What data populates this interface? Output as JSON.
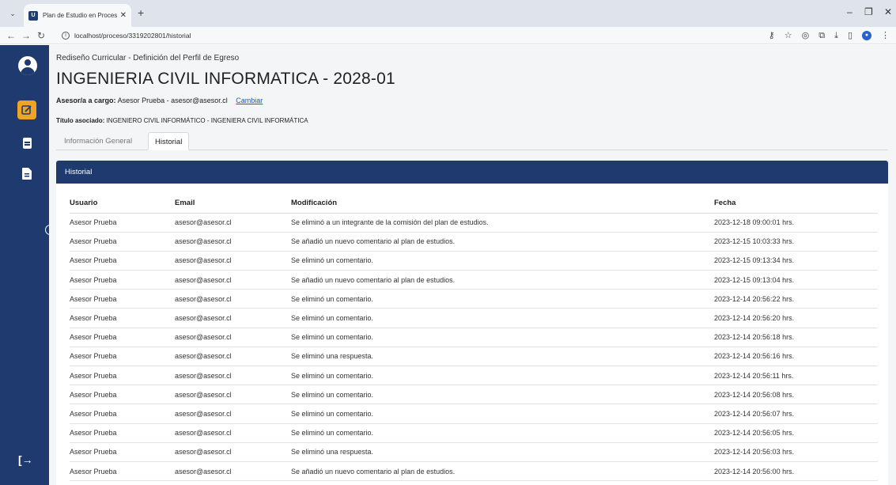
{
  "browser": {
    "tab_title": "Plan de Estudio en Proceso - Si",
    "tab_favicon": "U",
    "url": "localhost/proceso/3319202801/historial"
  },
  "sidebar": {
    "items": [
      {
        "name": "edit",
        "icon": "edit-icon"
      },
      {
        "name": "list",
        "icon": "document-icon"
      },
      {
        "name": "file",
        "icon": "file-icon"
      }
    ],
    "logout_icon": "logout-icon"
  },
  "header": {
    "subtitle": "Rediseño Curricular - Definición del Perfil de Egreso",
    "title": "INGENIERIA CIVIL INFORMATICA - 2028-01",
    "asesor_label": "Asesor/a a cargo:",
    "asesor_value": "Asesor Prueba - asesor@asesor.cl",
    "change_link": "Cambiar",
    "titulo_label": "Título asociado:",
    "titulo_value": "INGENIERO CIVIL INFORMÁTICO - INGENIERA CIVIL INFORMÁTICA"
  },
  "tabs": {
    "general": "Información General",
    "historial": "Historial"
  },
  "historial": {
    "card_title": "Historial",
    "columns": [
      "Usuario",
      "Email",
      "Modificación",
      "Fecha"
    ],
    "rows": [
      [
        "Asesor Prueba",
        "asesor@asesor.cl",
        "Se eliminó a un integrante de la comisión del plan de estudios.",
        "2023-12-18 09:00:01 hrs."
      ],
      [
        "Asesor Prueba",
        "asesor@asesor.cl",
        "Se añadió un nuevo comentario al plan de estudios.",
        "2023-12-15 10:03:33 hrs."
      ],
      [
        "Asesor Prueba",
        "asesor@asesor.cl",
        "Se eliminó un comentario.",
        "2023-12-15 09:13:34 hrs."
      ],
      [
        "Asesor Prueba",
        "asesor@asesor.cl",
        "Se añadió un nuevo comentario al plan de estudios.",
        "2023-12-15 09:13:04 hrs."
      ],
      [
        "Asesor Prueba",
        "asesor@asesor.cl",
        "Se eliminó un comentario.",
        "2023-12-14 20:56:22 hrs."
      ],
      [
        "Asesor Prueba",
        "asesor@asesor.cl",
        "Se eliminó un comentario.",
        "2023-12-14 20:56:20 hrs."
      ],
      [
        "Asesor Prueba",
        "asesor@asesor.cl",
        "Se eliminó un comentario.",
        "2023-12-14 20:56:18 hrs."
      ],
      [
        "Asesor Prueba",
        "asesor@asesor.cl",
        "Se eliminó una respuesta.",
        "2023-12-14 20:56:16 hrs."
      ],
      [
        "Asesor Prueba",
        "asesor@asesor.cl",
        "Se eliminó un comentario.",
        "2023-12-14 20:56:11 hrs."
      ],
      [
        "Asesor Prueba",
        "asesor@asesor.cl",
        "Se eliminó un comentario.",
        "2023-12-14 20:56:08 hrs."
      ],
      [
        "Asesor Prueba",
        "asesor@asesor.cl",
        "Se eliminó un comentario.",
        "2023-12-14 20:56:07 hrs."
      ],
      [
        "Asesor Prueba",
        "asesor@asesor.cl",
        "Se eliminó un comentario.",
        "2023-12-14 20:56:05 hrs."
      ],
      [
        "Asesor Prueba",
        "asesor@asesor.cl",
        "Se eliminó una respuesta.",
        "2023-12-14 20:56:03 hrs."
      ],
      [
        "Asesor Prueba",
        "asesor@asesor.cl",
        "Se añadió un nuevo comentario al plan de estudios.",
        "2023-12-14 20:56:00 hrs."
      ]
    ]
  },
  "colors": {
    "brand": "#1e3a6e",
    "accent": "#f0a522",
    "link": "#1a56c9"
  }
}
